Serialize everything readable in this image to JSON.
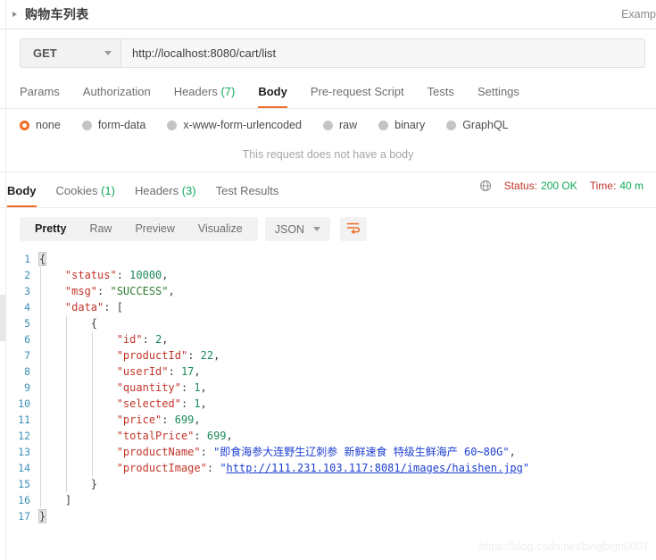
{
  "window": {
    "request_name": "购物车列表",
    "examples_label": "Examp",
    "collapse_icon": "triangle-right-icon"
  },
  "url_bar": {
    "method": "GET",
    "url": "http://localhost:8080/cart/list",
    "method_caret_icon": "chevron-down-icon"
  },
  "request_tabs": [
    {
      "label": "Params",
      "count": "",
      "active": false
    },
    {
      "label": "Authorization",
      "count": "",
      "active": false
    },
    {
      "label": "Headers",
      "count": "(7)",
      "active": false
    },
    {
      "label": "Body",
      "count": "",
      "active": true
    },
    {
      "label": "Pre-request Script",
      "count": "",
      "active": false
    },
    {
      "label": "Tests",
      "count": "",
      "active": false
    },
    {
      "label": "Settings",
      "count": "",
      "active": false
    }
  ],
  "body_types": [
    {
      "label": "none",
      "selected": true
    },
    {
      "label": "form-data",
      "selected": false
    },
    {
      "label": "x-www-form-urlencoded",
      "selected": false
    },
    {
      "label": "raw",
      "selected": false
    },
    {
      "label": "binary",
      "selected": false
    },
    {
      "label": "GraphQL",
      "selected": false
    }
  ],
  "body_empty_message": "This request does not have a body",
  "response_tabs": [
    {
      "label": "Body",
      "count": "",
      "active": true
    },
    {
      "label": "Cookies",
      "count": "(1)",
      "active": false
    },
    {
      "label": "Headers",
      "count": "(3)",
      "active": false
    },
    {
      "label": "Test Results",
      "count": "",
      "active": false
    }
  ],
  "response_meta": {
    "globe_icon": "globe-icon",
    "status_label": "Status:",
    "status_value": "200 OK",
    "time_label": "Time:",
    "time_value": "40 m"
  },
  "viewer_toolbar": {
    "modes": [
      {
        "label": "Pretty",
        "active": true
      },
      {
        "label": "Raw",
        "active": false
      },
      {
        "label": "Preview",
        "active": false
      },
      {
        "label": "Visualize",
        "active": false
      }
    ],
    "format": "JSON",
    "format_caret_icon": "chevron-down-icon",
    "wrap_icon": "wrap-lines-icon"
  },
  "response_body": {
    "lines": [
      {
        "num": "1",
        "indent": 0,
        "tokens": [
          {
            "t": "brace",
            "v": "{"
          }
        ]
      },
      {
        "num": "2",
        "indent": 1,
        "tokens": [
          {
            "t": "k",
            "v": "\"status\""
          },
          {
            "t": "p",
            "v": ": "
          },
          {
            "t": "n",
            "v": "10000"
          },
          {
            "t": "p",
            "v": ","
          }
        ]
      },
      {
        "num": "3",
        "indent": 1,
        "tokens": [
          {
            "t": "k",
            "v": "\"msg\""
          },
          {
            "t": "p",
            "v": ": "
          },
          {
            "t": "g",
            "v": "\"SUCCESS\""
          },
          {
            "t": "p",
            "v": ","
          }
        ]
      },
      {
        "num": "4",
        "indent": 1,
        "tokens": [
          {
            "t": "k",
            "v": "\"data\""
          },
          {
            "t": "p",
            "v": ": ["
          }
        ]
      },
      {
        "num": "5",
        "indent": 2,
        "tokens": [
          {
            "t": "p",
            "v": "{"
          }
        ]
      },
      {
        "num": "6",
        "indent": 3,
        "tokens": [
          {
            "t": "k",
            "v": "\"id\""
          },
          {
            "t": "p",
            "v": ": "
          },
          {
            "t": "n",
            "v": "2"
          },
          {
            "t": "p",
            "v": ","
          }
        ]
      },
      {
        "num": "7",
        "indent": 3,
        "tokens": [
          {
            "t": "k",
            "v": "\"productId\""
          },
          {
            "t": "p",
            "v": ": "
          },
          {
            "t": "n",
            "v": "22"
          },
          {
            "t": "p",
            "v": ","
          }
        ]
      },
      {
        "num": "8",
        "indent": 3,
        "tokens": [
          {
            "t": "k",
            "v": "\"userId\""
          },
          {
            "t": "p",
            "v": ": "
          },
          {
            "t": "n",
            "v": "17"
          },
          {
            "t": "p",
            "v": ","
          }
        ]
      },
      {
        "num": "9",
        "indent": 3,
        "tokens": [
          {
            "t": "k",
            "v": "\"quantity\""
          },
          {
            "t": "p",
            "v": ": "
          },
          {
            "t": "n",
            "v": "1"
          },
          {
            "t": "p",
            "v": ","
          }
        ]
      },
      {
        "num": "10",
        "indent": 3,
        "tokens": [
          {
            "t": "k",
            "v": "\"selected\""
          },
          {
            "t": "p",
            "v": ": "
          },
          {
            "t": "n",
            "v": "1"
          },
          {
            "t": "p",
            "v": ","
          }
        ]
      },
      {
        "num": "11",
        "indent": 3,
        "tokens": [
          {
            "t": "k",
            "v": "\"price\""
          },
          {
            "t": "p",
            "v": ": "
          },
          {
            "t": "n",
            "v": "699"
          },
          {
            "t": "p",
            "v": ","
          }
        ]
      },
      {
        "num": "12",
        "indent": 3,
        "tokens": [
          {
            "t": "k",
            "v": "\"totalPrice\""
          },
          {
            "t": "p",
            "v": ": "
          },
          {
            "t": "n",
            "v": "699"
          },
          {
            "t": "p",
            "v": ","
          }
        ]
      },
      {
        "num": "13",
        "indent": 3,
        "tokens": [
          {
            "t": "k",
            "v": "\"productName\""
          },
          {
            "t": "p",
            "v": ": "
          },
          {
            "t": "s",
            "v": "\"即食海参大连野生辽刺参 新鲜速食 特级生鲜海产 60~80G\""
          },
          {
            "t": "p",
            "v": ","
          }
        ]
      },
      {
        "num": "14",
        "indent": 3,
        "tokens": [
          {
            "t": "k",
            "v": "\"productImage\""
          },
          {
            "t": "p",
            "v": ": "
          },
          {
            "t": "s",
            "v": "\""
          },
          {
            "t": "lnk",
            "v": "http://111.231.103.117:8081/images/haishen.jpg"
          },
          {
            "t": "s",
            "v": "\""
          }
        ]
      },
      {
        "num": "15",
        "indent": 2,
        "tokens": [
          {
            "t": "p",
            "v": "}"
          }
        ]
      },
      {
        "num": "16",
        "indent": 1,
        "tokens": [
          {
            "t": "p",
            "v": "]"
          }
        ]
      },
      {
        "num": "17",
        "indent": 0,
        "tokens": [
          {
            "t": "brace",
            "v": "}"
          }
        ]
      }
    ]
  },
  "watermark": "https://blog.csdn.net/bingbign0607"
}
